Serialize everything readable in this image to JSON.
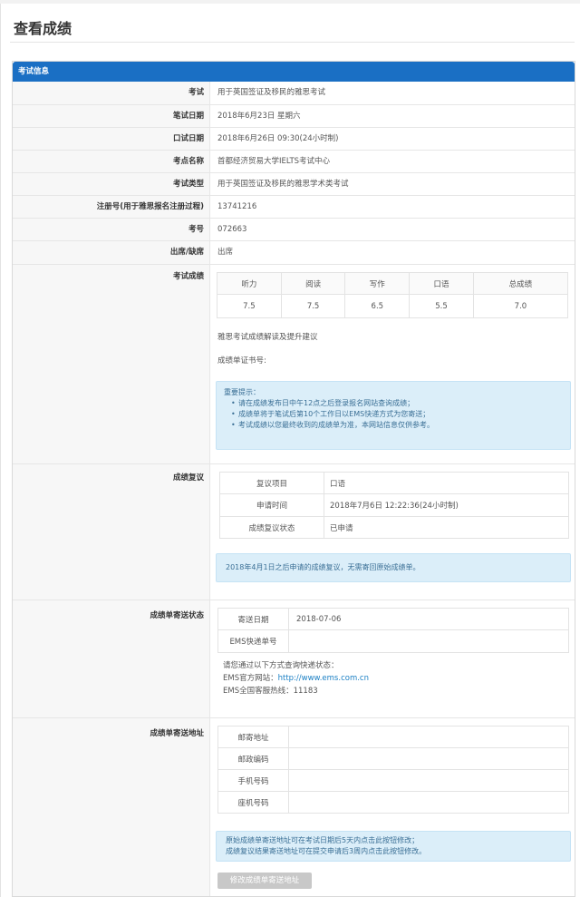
{
  "page_title": "查看成绩",
  "section_title": "考试信息",
  "info_rows": [
    {
      "label": "考试",
      "value": "用于英国签证及移民的雅思考试"
    },
    {
      "label": "笔试日期",
      "value": "2018年6月23日 星期六"
    },
    {
      "label": "口试日期",
      "value": "2018年6月26日 09:30(24小时制)"
    },
    {
      "label": "考点名称",
      "value": "首都经济贸易大学IELTS考试中心"
    },
    {
      "label": "考试类型",
      "value": "用于英国签证及移民的雅思学术类考试"
    },
    {
      "label": "注册号(用于雅思报名注册过程)",
      "value": "13741216"
    },
    {
      "label": "考号",
      "value": "072663"
    },
    {
      "label": "出席/缺席",
      "value": "出席"
    }
  ],
  "scores": {
    "label": "考试成绩",
    "headers": [
      "听力",
      "阅读",
      "写作",
      "口语",
      "总成绩"
    ],
    "values": [
      "7.5",
      "7.5",
      "6.5",
      "5.5",
      "7.0"
    ],
    "advice_link": "雅思考试成绩解读及提升建议",
    "cert_label": "成绩单证书号:",
    "notice_title": "重要提示：",
    "notice_items": [
      "请在成绩发布日中午12点之后登录报名网站查询成绩；",
      "成绩单将于笔试后第10个工作日以EMS快递方式为您寄送；",
      "考试成绩以您最终收到的成绩单为准，本网站信息仅供参考。"
    ]
  },
  "review": {
    "label": "成绩复议",
    "rows": [
      {
        "k": "复议项目",
        "v": "口语"
      },
      {
        "k": "申请时间",
        "v": "2018年7月6日 12:22:36(24小时制)"
      },
      {
        "k": "成绩复议状态",
        "v": "已申请"
      }
    ],
    "notice": "2018年4月1日之后申请的成绩复议，无需寄回原始成绩单。"
  },
  "mailing_status": {
    "label": "成绩单寄送状态",
    "rows": [
      {
        "k": "寄送日期",
        "v": "2018-07-06"
      },
      {
        "k": "EMS快递单号",
        "v": ""
      }
    ],
    "text1": "请您通过以下方式查询快递状态：",
    "text2_label": "EMS官方网站：",
    "text2_link": "http://www.ems.com.cn",
    "text3": "EMS全国客服热线：11183"
  },
  "mailing_address": {
    "label": "成绩单寄送地址",
    "rows": [
      {
        "k": "邮寄地址",
        "v": ""
      },
      {
        "k": "邮政编码",
        "v": ""
      },
      {
        "k": "手机号码",
        "v": ""
      },
      {
        "k": "座机号码",
        "v": ""
      }
    ],
    "notice_lines": [
      "原始成绩单寄送地址可在考试日期后5天内点击此按钮修改；",
      "成绩复议结果寄送地址可在提交申请后3周内点击此按钮修改。"
    ],
    "button": "修改成绩单寄送地址"
  }
}
